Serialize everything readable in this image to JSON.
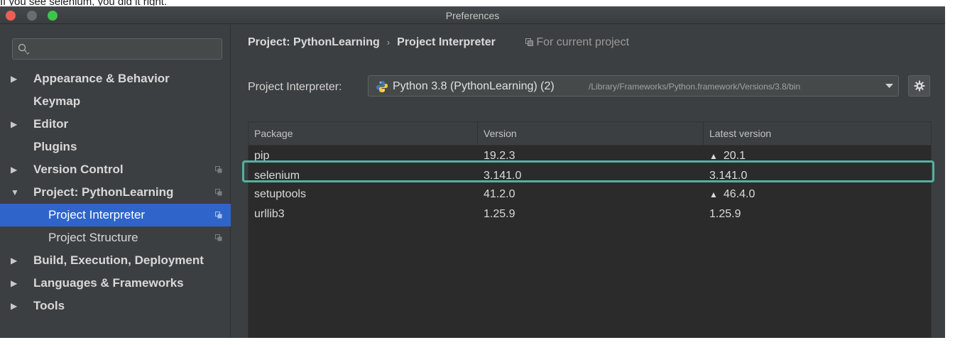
{
  "caption": "If you see selenium, you did it right.",
  "window": {
    "title": "Preferences",
    "controls": [
      "close",
      "minimize",
      "zoom"
    ]
  },
  "sidebar": {
    "search": {
      "value": "",
      "placeholder": ""
    },
    "items": [
      {
        "label": "Appearance & Behavior",
        "arrow": "▶",
        "level": 0
      },
      {
        "label": "Keymap",
        "arrow": "",
        "level": 0
      },
      {
        "label": "Editor",
        "arrow": "▶",
        "level": 0
      },
      {
        "label": "Plugins",
        "arrow": "",
        "level": 0
      },
      {
        "label": "Version Control",
        "arrow": "▶",
        "level": 0,
        "icon": "project-scope-icon"
      },
      {
        "label": "Project: PythonLearning",
        "arrow": "▼",
        "level": 0,
        "icon": "project-scope-icon"
      },
      {
        "label": "Project Interpreter",
        "arrow": "",
        "level": 1,
        "selected": true,
        "icon": "project-scope-icon"
      },
      {
        "label": "Project Structure",
        "arrow": "",
        "level": 1,
        "icon": "project-scope-icon"
      },
      {
        "label": "Build, Execution, Deployment",
        "arrow": "▶",
        "level": 0
      },
      {
        "label": "Languages & Frameworks",
        "arrow": "▶",
        "level": 0
      },
      {
        "label": "Tools",
        "arrow": "▶",
        "level": 0
      }
    ]
  },
  "main": {
    "breadcrumb": {
      "parent": "Project: PythonLearning",
      "separator": "›",
      "current": "Project Interpreter",
      "scope": "For current project"
    },
    "interpreter": {
      "label": "Project Interpreter:",
      "name": "Python 3.8 (PythonLearning) (2)",
      "path": "/Library/Frameworks/Python.framework/Versions/3.8/bin"
    },
    "packages": {
      "columns": [
        "Package",
        "Version",
        "Latest version"
      ],
      "rows": [
        {
          "package": "pip",
          "version": "19.2.3",
          "latest": "20.1",
          "upgrade": true
        },
        {
          "package": "selenium",
          "version": "3.141.0",
          "latest": "3.141.0",
          "upgrade": false
        },
        {
          "package": "setuptools",
          "version": "41.2.0",
          "latest": "46.4.0",
          "upgrade": true
        },
        {
          "package": "urllib3",
          "version": "1.25.9",
          "latest": "1.25.9",
          "upgrade": false
        }
      ],
      "highlighted": "selenium"
    }
  },
  "colors": {
    "background": "#3c3f41",
    "selection": "#2f65ca",
    "table": "#2b2b2b",
    "highlight": "#4fb3a0"
  }
}
